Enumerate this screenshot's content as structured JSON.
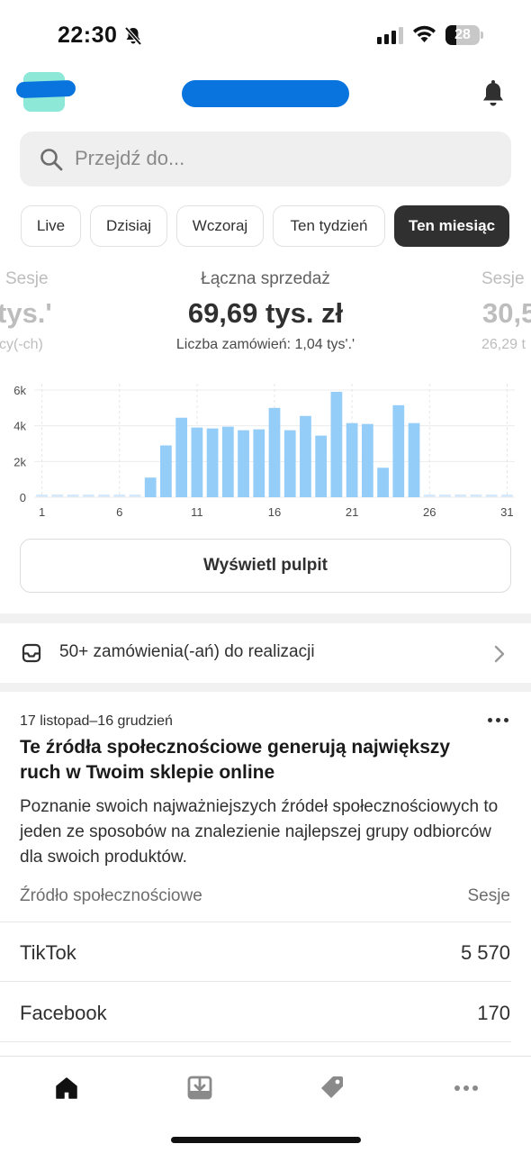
{
  "status_bar": {
    "time": "22:30",
    "battery": "28",
    "icons": [
      "bell-off-icon",
      "signal-icon",
      "wifi-icon",
      "battery-icon"
    ]
  },
  "header": {
    "icons": [
      "store-avatar",
      "notification-bell-icon"
    ]
  },
  "search": {
    "placeholder": "Przejdź do..."
  },
  "periods": [
    {
      "label": "Live",
      "active": false
    },
    {
      "label": "Dzisiaj",
      "active": false
    },
    {
      "label": "Wczoraj",
      "active": false
    },
    {
      "label": "Ten tydzień",
      "active": false
    },
    {
      "label": "Ten miesiąc",
      "active": true
    }
  ],
  "metrics": {
    "left": {
      "label": "Sesje",
      "value": "tys.'",
      "sub": "cy(-ch)"
    },
    "center": {
      "label": "Łączna sprzedaż",
      "value": "69,69 tys. zł",
      "sub": "Liczba zamówień: 1,04 tys'.'"
    },
    "right": {
      "label": "Sesje",
      "value": "30,5",
      "sub": "26,29 t"
    }
  },
  "chart_data": {
    "type": "bar",
    "x": [
      1,
      2,
      3,
      4,
      5,
      6,
      7,
      8,
      9,
      10,
      11,
      12,
      13,
      14,
      15,
      16,
      17,
      18,
      19,
      20,
      21,
      22,
      23,
      24,
      25,
      26,
      27,
      28,
      29,
      30,
      31
    ],
    "values": [
      0,
      0,
      0,
      0,
      0,
      0,
      0,
      1100,
      2900,
      4450,
      3900,
      3850,
      3950,
      3750,
      3800,
      5000,
      3750,
      4550,
      3450,
      5900,
      4150,
      4100,
      1650,
      5150,
      4150,
      0,
      0,
      0,
      0,
      0,
      0
    ],
    "xticks": [
      "1",
      "6",
      "11",
      "16",
      "21",
      "26",
      "31"
    ],
    "yticks": [
      "0",
      "2k",
      "4k",
      "6k"
    ],
    "ylim": [
      0,
      6000
    ],
    "color": "#94cdf8",
    "zero_color": "#d4e9fb",
    "grid": true
  },
  "dashboard_button": {
    "label": "Wyświetl pulpit"
  },
  "orders": {
    "label": "50+ zamówienia(-ań) do realizacji"
  },
  "insight": {
    "date_range": "17 listopad–16 grudzień",
    "title": "Te źródła społecznościowe generują największy ruch w Twoim sklepie online",
    "description": "Poznanie swoich najważniejszych źródeł społecznościowych to jeden ze sposobów na znalezienie najlepszej grupy odbiorców dla swoich produktów.",
    "col_source": "Źródło społecznościowe",
    "col_sessions": "Sesje",
    "rows": [
      {
        "source": "TikTok",
        "sessions": "5 570"
      },
      {
        "source": "Facebook",
        "sessions": "170"
      }
    ]
  },
  "bottom_nav": {
    "items": [
      "home-icon",
      "orders-download-icon",
      "products-tag-icon",
      "more-icon"
    ]
  },
  "colors": {
    "accent_dark": "#303030",
    "bar": "#94cdf8",
    "redaction": "#0a74de"
  }
}
